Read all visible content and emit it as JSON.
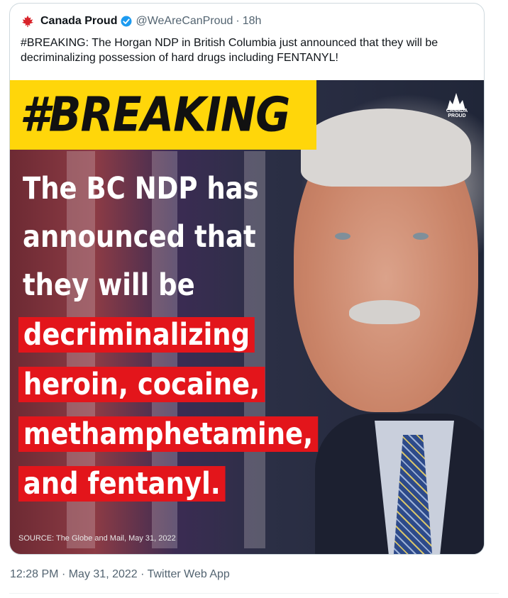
{
  "tweet": {
    "author_name": "Canada Proud",
    "handle": "@WeAreCanProud",
    "separator": "·",
    "relative_time": "18h",
    "text": "#BREAKING: The Horgan NDP in British Columbia just announced that they will be decriminalizing possession of hard drugs including FENTANYL!"
  },
  "media": {
    "banner": "#BREAKING",
    "logo_text": "CANADA PROUD",
    "lines": [
      "The BC NDP has",
      "announced that",
      "they will be",
      "decriminalizing",
      "heroin, cocaine,",
      "methamphetamine,",
      "and fentanyl."
    ],
    "source": "SOURCE: The Globe and Mail, May 31, 2022"
  },
  "footer": {
    "time": "12:28 PM",
    "separator": "·",
    "date": "May 31, 2022",
    "client": "Twitter Web App"
  },
  "colors": {
    "verified": "#1d9bf0",
    "banner": "#ffd60a",
    "highlight": "#e3151b",
    "muted_text": "#536471"
  }
}
